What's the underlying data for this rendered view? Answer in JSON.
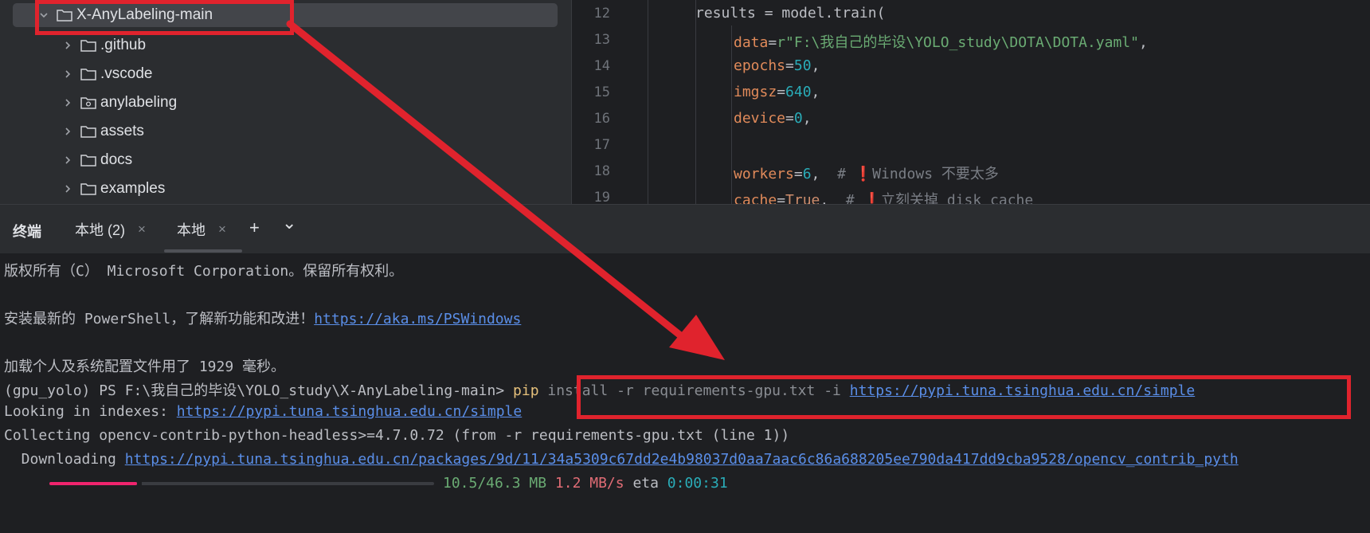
{
  "project_tree": {
    "root": {
      "name": "X-AnyLabeling-main",
      "icon": "folder-icon"
    },
    "items": [
      {
        "name": ".github",
        "icon": "folder-icon"
      },
      {
        "name": ".vscode",
        "icon": "folder-icon"
      },
      {
        "name": "anylabeling",
        "icon": "package-folder-icon"
      },
      {
        "name": "assets",
        "icon": "folder-icon"
      },
      {
        "name": "docs",
        "icon": "folder-icon"
      },
      {
        "name": "examples",
        "icon": "folder-icon"
      }
    ]
  },
  "editor": {
    "line_numbers": [
      "12",
      "13",
      "14",
      "15",
      "16",
      "17",
      "18",
      "19"
    ],
    "lines": {
      "l12": "results = model.train(",
      "l13_param": "data",
      "l13_value": "r\"F:\\我自己的毕设\\YOLO_study\\DOTA\\DOTA.yaml\"",
      "l14_param": "epochs",
      "l14_value": "50",
      "l15_param": "imgsz",
      "l15_value": "640",
      "l16_param": "device",
      "l16_value": "0",
      "l18_param": "workers",
      "l18_value": "6",
      "l18_comment": "Windows 不要太多",
      "l19_param": "cache",
      "l19_value": "True",
      "l19_comment": "立刻关掉 disk cache"
    }
  },
  "terminal_bar": {
    "title": "终端",
    "tabs": [
      {
        "label": "本地 (2)"
      },
      {
        "label": "本地"
      }
    ],
    "close_glyph": "×",
    "add_glyph": "+",
    "more_glyph": "⌄"
  },
  "terminal": {
    "copyright": "版权所有（C） Microsoft Corporation。保留所有权利。",
    "ps_hint_text": "安装最新的 PowerShell，了解新功能和改进！",
    "ps_hint_link": "https://aka.ms/PSWindows",
    "load_msg": "加载个人及系统配置文件用了 1929 毫秒。",
    "prompt": "(gpu_yolo) PS F:\\我自己的毕设\\YOLO_study\\X-AnyLabeling-main>",
    "cmd_pip": "pip",
    "cmd_install": "install",
    "cmd_flag_r": "-r",
    "cmd_file": "requirements-gpu.txt",
    "cmd_flag_i": "-i",
    "cmd_url": "https://pypi.tuna.tsinghua.edu.cn/simple",
    "looking_label": "Looking in indexes: ",
    "looking_url": "https://pypi.tuna.tsinghua.edu.cn/simple",
    "collecting": "Collecting opencv-contrib-python-headless>=4.7.0.72 (from -r requirements-gpu.txt (line 1))",
    "downloading_label": "  Downloading ",
    "downloading_url": "https://pypi.tuna.tsinghua.edu.cn/packages/9d/11/34a5309c67dd2e4b98037d0aa7aac6c86a688205ee790da417dd9cba9528/opencv_contrib_pyth",
    "progress_fraction": 0.227,
    "progress_size": "10.5/46.3 MB",
    "progress_speed": "1.2 MB/s",
    "progress_eta_label": "eta",
    "progress_eta": "0:00:31"
  },
  "colors": {
    "annotation_red": "#e0232d",
    "progress_pink": "#f0246e"
  }
}
